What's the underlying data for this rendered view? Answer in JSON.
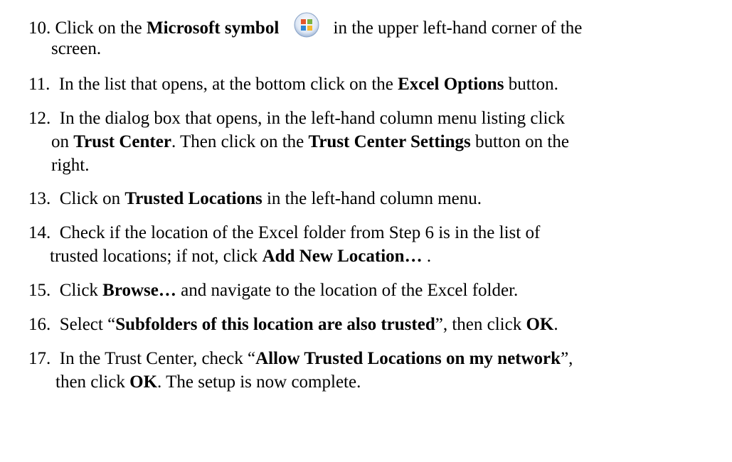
{
  "steps": [
    {
      "number": "10.",
      "parts": [
        "Click on the ",
        "Microsoft symbol",
        "in the upper left-hand corner of the"
      ],
      "cont": [
        "screen."
      ]
    },
    {
      "number": "11.",
      "parts": [
        "In the list that opens, at the bottom click on the ",
        "Excel Options",
        " button."
      ]
    },
    {
      "number": "12.",
      "parts": [
        "In the dialog box that opens, in the left-hand column menu listing click"
      ],
      "cont": [
        "on ",
        "Trust Center",
        ".  Then click on the ",
        "Trust Center Settings",
        " button on the"
      ],
      "cont2": [
        "right."
      ]
    },
    {
      "number": "13.",
      "parts": [
        "Click on ",
        "Trusted Locations",
        " in the left-hand column menu."
      ]
    },
    {
      "number": "14.",
      "parts": [
        "Check if the location of the Excel folder from Step 6 is in the list of"
      ],
      "cont": [
        "trusted locations; if not, click ",
        "Add New Location…",
        " ."
      ]
    },
    {
      "number": "15.",
      "parts": [
        "Click ",
        "Browse…",
        " and navigate to the location of the Excel folder."
      ]
    },
    {
      "number": "16.",
      "parts": [
        "Select “",
        "Subfolders of this location are also trusted",
        "”, then click ",
        "OK",
        "."
      ]
    },
    {
      "number": "17.",
      "parts": [
        "In the Trust Center, check “",
        "Allow Trusted Locations on my network",
        "”,"
      ],
      "cont": [
        "then click ",
        "OK",
        ".  The setup is now complete."
      ]
    }
  ],
  "icon": "office-button-icon"
}
